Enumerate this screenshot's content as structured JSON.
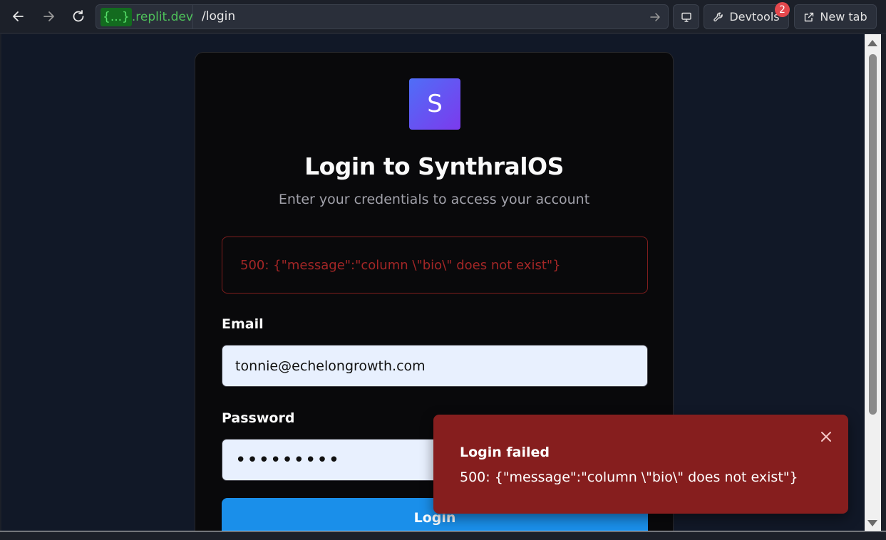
{
  "browser": {
    "url_host_prefix": "{...}",
    "url_host_suffix": ".replit.dev",
    "url_path": "/login",
    "devtools_label": "Devtools",
    "devtools_badge": "2",
    "new_tab_label": "New tab"
  },
  "login": {
    "logo_letter": "S",
    "title": "Login to SynthralOS",
    "subtitle": "Enter your credentials to access your account",
    "error_message": "500: {\"message\":\"column \\\"bio\\\" does not exist\"}",
    "email_label": "Email",
    "email_value": "tonnie@echelongrowth.com",
    "password_label": "Password",
    "password_value": "•••••••••",
    "submit_label": "Login"
  },
  "toast": {
    "title": "Login failed",
    "message": "500: {\"message\":\"column \\\"bio\\\" does not exist\"}"
  },
  "colors": {
    "page_bg": "#111827",
    "card_bg": "#09090b",
    "primary_button": "#1a8fea",
    "toast_bg": "#861e1e",
    "error_text": "#a32626",
    "badge": "#e5484d"
  }
}
